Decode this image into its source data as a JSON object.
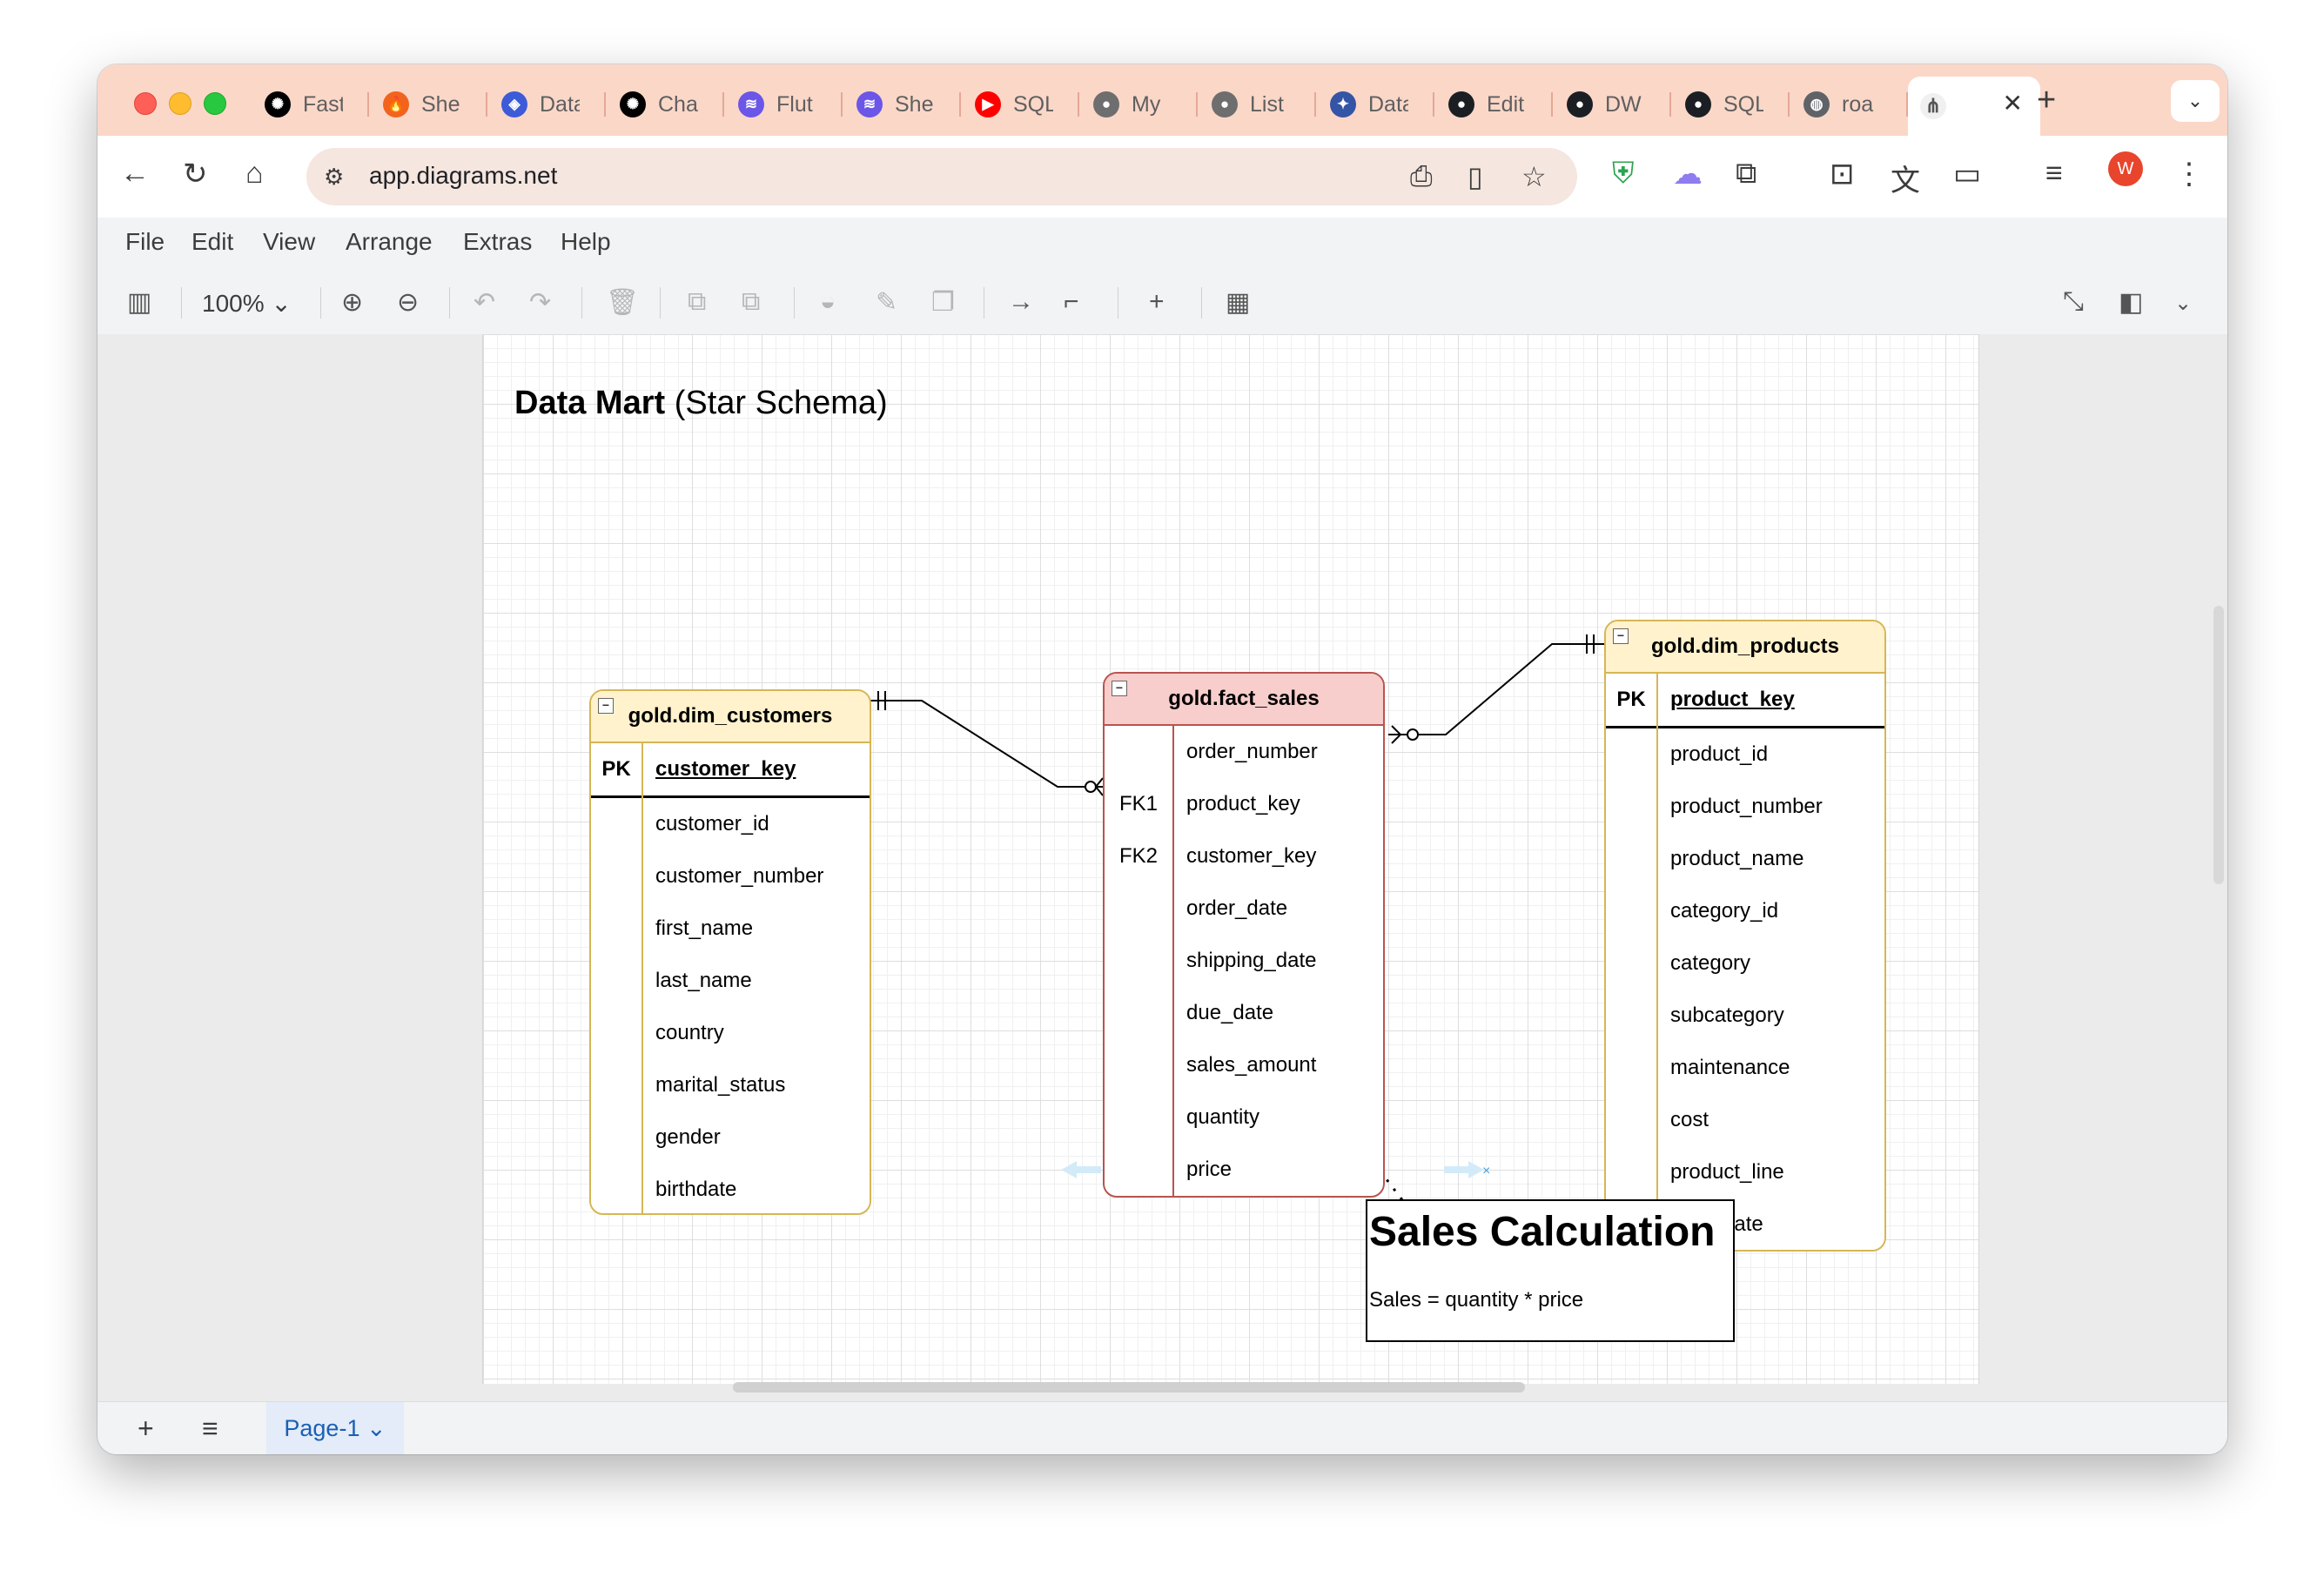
{
  "browser": {
    "tabs": [
      {
        "label": "Fast",
        "icon": "openai-icon",
        "color": "#000000",
        "glyph": "✺"
      },
      {
        "label": "She",
        "icon": "flame-icon",
        "color": "#f2641d",
        "glyph": "🔥"
      },
      {
        "label": "Data",
        "icon": "shield-icon",
        "color": "#3d5bd9",
        "glyph": "◈"
      },
      {
        "label": "Cha",
        "icon": "openai-icon",
        "color": "#000000",
        "glyph": "✺"
      },
      {
        "label": "Flut",
        "icon": "stack-icon",
        "color": "#6b56e8",
        "glyph": "≋"
      },
      {
        "label": "She",
        "icon": "stack-icon",
        "color": "#6b56e8",
        "glyph": "≋"
      },
      {
        "label": "SQL",
        "icon": "youtube-icon",
        "color": "#ff0000",
        "glyph": "▶"
      },
      {
        "label": "My",
        "icon": "avatar-icon",
        "color": "#6e6e6e",
        "glyph": "●"
      },
      {
        "label": "List",
        "icon": "avatar-icon",
        "color": "#6e6e6e",
        "glyph": "●"
      },
      {
        "label": "Data",
        "icon": "illustration-icon",
        "color": "#3455a6",
        "glyph": "✦"
      },
      {
        "label": "Edit",
        "icon": "github-icon",
        "color": "#1b1f23",
        "glyph": "●"
      },
      {
        "label": "DW",
        "icon": "github-icon",
        "color": "#1b1f23",
        "glyph": "●"
      },
      {
        "label": "SQL",
        "icon": "github-icon",
        "color": "#1b1f23",
        "glyph": "●"
      },
      {
        "label": "roa",
        "icon": "globe-icon",
        "color": "#5f6368",
        "glyph": "◍"
      }
    ],
    "active_tab_icon": "drawio-icon",
    "url": "app.diagrams.net",
    "avatar_letter": "W"
  },
  "app": {
    "menu": [
      "File",
      "Edit",
      "View",
      "Arrange",
      "Extras",
      "Help"
    ],
    "zoom": "100%",
    "page_tab": "Page-1"
  },
  "diagram": {
    "title_bold": "Data Mart",
    "title_rest": " (Star Schema)",
    "customers": {
      "name": "gold.dim_customers",
      "pk_label": "PK",
      "pk_field": "customer_key",
      "fields": [
        "customer_id",
        "customer_number",
        "first_name",
        "last_name",
        "country",
        "marital_status",
        "gender",
        "birthdate"
      ]
    },
    "fact": {
      "name": "gold.fact_sales",
      "rows": [
        {
          "key": "",
          "field": "order_number"
        },
        {
          "key": "FK1",
          "field": "product_key"
        },
        {
          "key": "FK2",
          "field": "customer_key"
        },
        {
          "key": "",
          "field": "order_date"
        },
        {
          "key": "",
          "field": "shipping_date"
        },
        {
          "key": "",
          "field": "due_date"
        },
        {
          "key": "",
          "field": "sales_amount"
        },
        {
          "key": "",
          "field": "quantity"
        },
        {
          "key": "",
          "field": "price"
        }
      ]
    },
    "products": {
      "name": "gold.dim_products",
      "pk_label": "PK",
      "pk_field": "product_key",
      "fields": [
        "product_id",
        "product_number",
        "product_name",
        "category_id",
        "category",
        "subcategory",
        "maintenance",
        "cost",
        "product_line",
        "start_date"
      ]
    },
    "note": {
      "title": "Sales Calculation",
      "body": "Sales = quantity * price"
    },
    "colors": {
      "dim_fill": "#fff2cc",
      "dim_stroke": "#d6b656",
      "fact_fill": "#f8cecc",
      "fact_stroke": "#b85450"
    }
  }
}
